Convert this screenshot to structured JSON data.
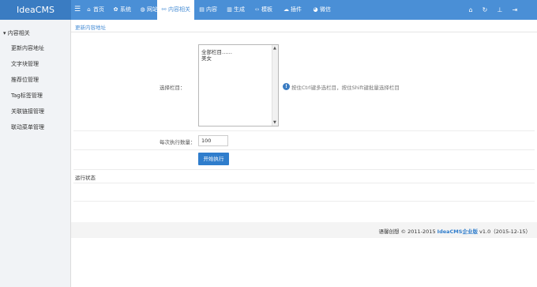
{
  "app": {
    "logo": "IdeaCMS"
  },
  "nav": [
    {
      "icon": "home-icon",
      "glyph": "⌂",
      "label": "首页"
    },
    {
      "icon": "gear-icon",
      "glyph": "✿",
      "label": "系统"
    },
    {
      "icon": "globe-icon",
      "glyph": "◍",
      "label": "网站"
    },
    {
      "icon": "link-icon",
      "glyph": "⚯",
      "label": "内容相关",
      "active": true
    },
    {
      "icon": "list-icon",
      "glyph": "▤",
      "label": "内容"
    },
    {
      "icon": "trash-icon",
      "glyph": "▥",
      "label": "生成"
    },
    {
      "icon": "code-icon",
      "glyph": "‹›",
      "label": "模板"
    },
    {
      "icon": "cloud-icon",
      "glyph": "☁",
      "label": "插件"
    },
    {
      "icon": "wechat-icon",
      "glyph": "◕",
      "label": "微信"
    }
  ],
  "sidebar": {
    "heading": "内容相关",
    "items": [
      {
        "label": "更新内容地址"
      },
      {
        "label": "文字块管理"
      },
      {
        "label": "推荐位管理"
      },
      {
        "label": "Tag标签管理"
      },
      {
        "label": "关联链接管理"
      },
      {
        "label": "联动菜单管理"
      }
    ]
  },
  "main": {
    "breadcrumb": "更新内容地址",
    "select_label": "选择栏目：",
    "options": [
      "全部栏目……",
      "美女"
    ],
    "hint": "按住Ctrl键多选栏目，按住Shift键批量选择栏目",
    "per_run_label": "每次执行数量：",
    "per_run_value": "100",
    "start_button": "开始执行",
    "status_label": "运行状态"
  },
  "footer": {
    "prefix": "语馨创想 © 2011-2015",
    "brand": "IdeaCMS企业版",
    "suffix": "v1.0（2015-12-15）"
  }
}
